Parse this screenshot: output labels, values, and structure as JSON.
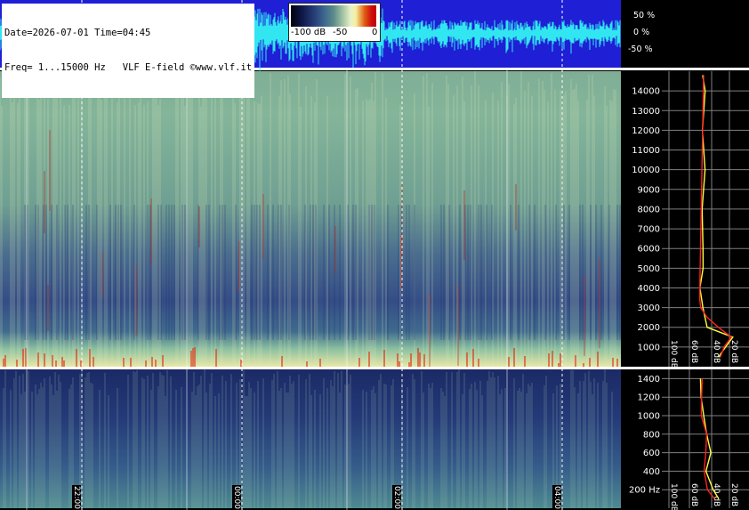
{
  "header": {
    "line1": "Date=2026-07-01 Time=04:45",
    "line2": "Freq= 1...15000 Hz   VLF E-field ©www.vlf.it"
  },
  "colorbar": {
    "labels": [
      "-100 dB",
      "-50",
      "0"
    ]
  },
  "waveform_axis": {
    "labels": [
      "50 %",
      "0 %",
      "-50 %"
    ]
  },
  "time_axis": {
    "labels": [
      "22:00",
      "00:00",
      "02:00",
      "04:00"
    ]
  },
  "colors": {
    "waveform_bg": "#1f1fd6",
    "waveform_trace": "#31e6f0",
    "spectrum_curve_yellow": "#ffff40",
    "spectrum_curve_red": "#ff2020",
    "grid": "#ffffff"
  },
  "chart_data": [
    {
      "type": "line",
      "title": "",
      "xlabel": "",
      "ylabel": "",
      "ylim": [
        -50,
        50
      ],
      "yticks": [
        "50 %",
        "0 %",
        "-50 %"
      ],
      "series": [
        {
          "values": []
        }
      ]
    },
    {
      "type": "heatmap",
      "title": "",
      "x": [
        "22:00",
        "00:00",
        "02:00",
        "04:00"
      ],
      "ylim": [
        0,
        15000
      ],
      "yticks": [
        1000,
        2000,
        3000,
        4000,
        5000,
        6000,
        7000,
        8000,
        9000,
        10000,
        11000,
        12000,
        13000,
        14000
      ],
      "colorbar": {
        "min": -100,
        "max": 0,
        "ticks": [
          "-100 dB",
          "-50",
          "0"
        ]
      }
    },
    {
      "type": "heatmap",
      "title": "",
      "x": [
        "22:00",
        "00:00",
        "02:00",
        "04:00"
      ],
      "ylim": [
        0,
        1500
      ],
      "yticks": [
        "200 Hz",
        400,
        600,
        800,
        1000,
        1200,
        1400
      ]
    },
    {
      "type": "line",
      "title": "",
      "xticks": [
        "100 dB",
        "60 dB",
        "40 dB",
        "20 dB"
      ],
      "yticks": [
        1000,
        2000,
        3000,
        4000,
        5000,
        6000,
        7000,
        8000,
        9000,
        10000,
        11000,
        12000,
        13000,
        14000
      ],
      "ylim": [
        0,
        15000
      ],
      "series": [
        {
          "values_freq": [
            500,
            1000,
            1500,
            2000,
            3000,
            4000,
            5000,
            6000,
            8000,
            10000,
            12000,
            14000,
            14800
          ],
          "values_db": [
            -40,
            -30,
            -20,
            -55,
            -63,
            -64,
            -62,
            -62,
            -60,
            -60,
            -60,
            -60,
            -60
          ]
        },
        {
          "values_freq": [
            500,
            1000,
            1500,
            2000,
            2500,
            3000,
            3500,
            14800
          ],
          "values_db": [
            -38,
            -32,
            -22,
            -40,
            -55,
            -62,
            -63,
            -62
          ]
        }
      ]
    },
    {
      "type": "line",
      "title": "",
      "xticks": [
        "100 dB",
        "60 dB",
        "40 dB",
        "20 dB"
      ],
      "yticks": [
        "200 Hz",
        400,
        600,
        800,
        1000,
        1200,
        1400
      ],
      "ylim": [
        0,
        1500
      ],
      "series": [
        {
          "values_freq": [
            100,
            200,
            400,
            600,
            800,
            1000,
            1200,
            1400
          ],
          "values_db": [
            -40,
            -50,
            -55,
            -52,
            -56,
            -60,
            -62,
            -62
          ]
        },
        {
          "values_freq": [
            100,
            200,
            400,
            600,
            800,
            1000,
            1200,
            1400
          ],
          "values_db": [
            -45,
            -55,
            -58,
            -56,
            -58,
            -62,
            -63,
            -63
          ]
        }
      ]
    }
  ]
}
